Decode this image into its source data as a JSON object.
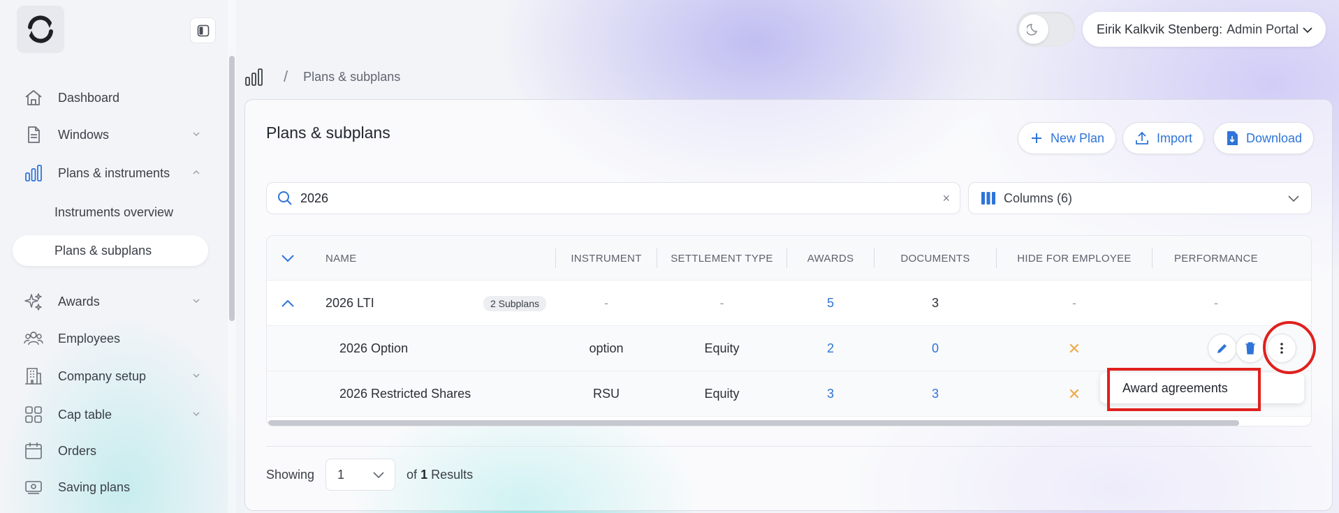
{
  "header": {
    "user_name": "Eirik Kalkvik Stenberg:",
    "portal": "Admin Portal"
  },
  "sidebar": {
    "items": [
      {
        "label": "Dashboard"
      },
      {
        "label": "Windows"
      },
      {
        "label": "Plans & instruments"
      },
      {
        "label": "Instruments overview"
      },
      {
        "label": "Plans & subplans"
      },
      {
        "label": "Awards"
      },
      {
        "label": "Employees"
      },
      {
        "label": "Company setup"
      },
      {
        "label": "Cap table"
      },
      {
        "label": "Orders"
      },
      {
        "label": "Saving plans"
      }
    ]
  },
  "breadcrumb": {
    "separator": "/",
    "current": "Plans & subplans"
  },
  "page": {
    "title": "Plans & subplans",
    "new_plan": "New Plan",
    "import": "Import",
    "download": "Download",
    "search_value": "2026",
    "clear": "×",
    "columns": "Columns (6)"
  },
  "table": {
    "headers": [
      "NAME",
      "INSTRUMENT",
      "SETTLEMENT TYPE",
      "AWARDS",
      "DOCUMENTS",
      "HIDE FOR EMPLOYEE",
      "PERFORMANCE"
    ],
    "rows": [
      {
        "name": "2026 LTI",
        "badge": "2 Subplans",
        "instrument": "-",
        "settlement": "-",
        "awards": "5",
        "documents": "3",
        "hide": "-",
        "performance": "-"
      },
      {
        "name": "2026 Option",
        "instrument": "option",
        "settlement": "Equity",
        "awards": "2",
        "documents": "0",
        "hide": "✕"
      },
      {
        "name": "2026 Restricted Shares",
        "instrument": "RSU",
        "settlement": "Equity",
        "awards": "3",
        "documents": "3",
        "hide": "✕"
      }
    ]
  },
  "menu": {
    "award_agreements": "Award agreements"
  },
  "footer": {
    "showing": "Showing",
    "page": "1",
    "of": "of",
    "total": "1",
    "results": "Results"
  },
  "colors": {
    "accent": "#2f74d8",
    "warning": "#f0a94a",
    "highlight": "#e0201d"
  }
}
